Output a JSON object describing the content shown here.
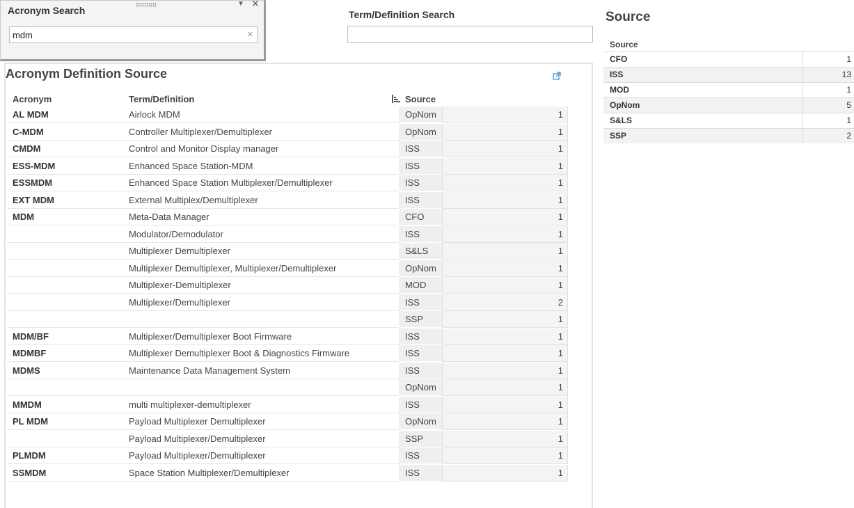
{
  "acronym_search": {
    "title": "Acronym Search",
    "value": "mdm",
    "clear_symbol": "×"
  },
  "term_search": {
    "title": "Term/Definition Search",
    "value": ""
  },
  "main": {
    "title": "Acronym Definition Source",
    "columns": {
      "acronym": "Acronym",
      "definition": "Term/Definition",
      "source": "Source"
    },
    "rows": [
      {
        "acronym": "AL MDM",
        "definition": "Airlock MDM",
        "source": "OpNom",
        "count": "1"
      },
      {
        "acronym": "C-MDM",
        "definition": "Controller Multiplexer/Demultiplexer",
        "source": "OpNom",
        "count": "1"
      },
      {
        "acronym": "CMDM",
        "definition": "Control and Monitor Display manager",
        "source": "ISS",
        "count": "1"
      },
      {
        "acronym": "ESS-MDM",
        "definition": "Enhanced Space Station-MDM",
        "source": "ISS",
        "count": "1"
      },
      {
        "acronym": "ESSMDM",
        "definition": "Enhanced Space Station Multiplexer/Demultiplexer",
        "source": "ISS",
        "count": "1"
      },
      {
        "acronym": "EXT MDM",
        "definition": "External Multiplex/Demultiplexer",
        "source": "ISS",
        "count": "1"
      },
      {
        "acronym": "MDM",
        "definition": "Meta-Data Manager",
        "source": "CFO",
        "count": "1"
      },
      {
        "acronym": "",
        "definition": "Modulator/Demodulator",
        "source": "ISS",
        "count": "1"
      },
      {
        "acronym": "",
        "definition": "Multiplexer Demultiplexer",
        "source": "S&LS",
        "count": "1"
      },
      {
        "acronym": "",
        "definition": "Multiplexer Demultiplexer, Multiplexer/Demultiplexer",
        "source": "OpNom",
        "count": "1"
      },
      {
        "acronym": "",
        "definition": "Multiplexer-Demultiplexer",
        "source": "MOD",
        "count": "1"
      },
      {
        "acronym": "",
        "definition": "Multiplexer/Demultiplexer",
        "source": "ISS",
        "count": "2"
      },
      {
        "acronym": "",
        "definition": "",
        "source": "SSP",
        "count": "1"
      },
      {
        "acronym": "MDM/BF",
        "definition": "Multiplexer/Demultiplexer Boot Firmware",
        "source": "ISS",
        "count": "1"
      },
      {
        "acronym": "MDMBF",
        "definition": "Multiplexer Demultiplexer Boot & Diagnostics Firmware",
        "source": "ISS",
        "count": "1"
      },
      {
        "acronym": "MDMS",
        "definition": "Maintenance Data Management System",
        "source": "ISS",
        "count": "1"
      },
      {
        "acronym": "",
        "definition": "",
        "source": "OpNom",
        "count": "1"
      },
      {
        "acronym": "MMDM",
        "definition": "multi multiplexer-demultiplexer",
        "source": "ISS",
        "count": "1"
      },
      {
        "acronym": "PL MDM",
        "definition": "Payload Multiplexer Demultiplexer",
        "source": "OpNom",
        "count": "1"
      },
      {
        "acronym": "",
        "definition": "Payload Multiplexer/Demultiplexer",
        "source": "SSP",
        "count": "1"
      },
      {
        "acronym": "PLMDM",
        "definition": "Payload Multiplexer/Demultiplexer",
        "source": "ISS",
        "count": "1"
      },
      {
        "acronym": "SSMDM",
        "definition": "Space Station Multiplexer/Demultiplexer",
        "source": "ISS",
        "count": "1"
      }
    ]
  },
  "source_panel": {
    "title": "Source",
    "column": "Source",
    "rows": [
      {
        "name": "CFO",
        "count": "1"
      },
      {
        "name": "ISS",
        "count": "13"
      },
      {
        "name": "MOD",
        "count": "1"
      },
      {
        "name": "OpNom",
        "count": "5"
      },
      {
        "name": "S&LS",
        "count": "1"
      },
      {
        "name": "SSP",
        "count": "2"
      }
    ]
  },
  "icons": {
    "grip": "drag-handle-icon",
    "menu": "dropdown-arrow-icon",
    "close": "close-icon",
    "export": "pop-out-icon",
    "sort": "sort-bars-icon"
  },
  "colors": {
    "panel_border": "#d9e6f0",
    "source_cell_bg": "#efefef",
    "count_cell_bg": "#f4f4f4"
  }
}
